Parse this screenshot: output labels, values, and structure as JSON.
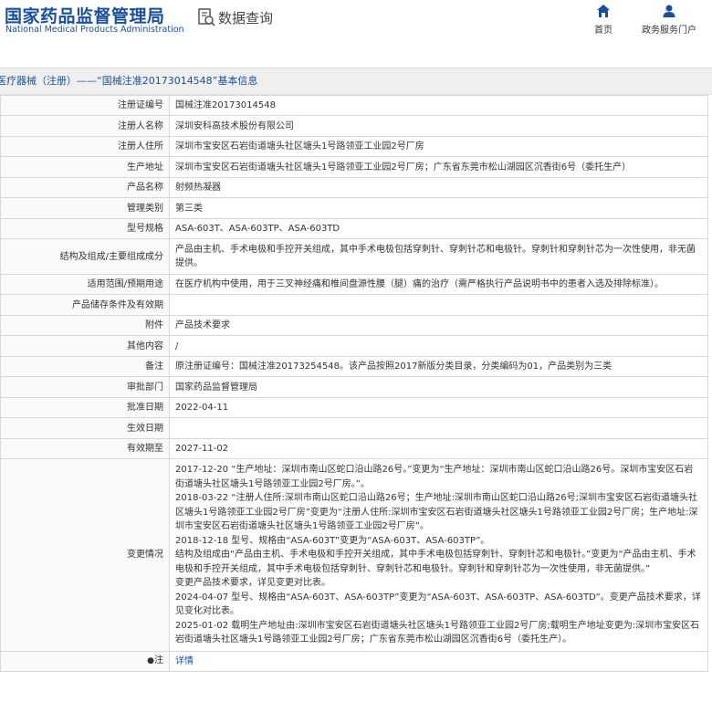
{
  "header": {
    "logo_cn": "国家药品监督管理局",
    "logo_en": "National Medical Products Administration",
    "search_label": "数据查询",
    "nav_home": "首页",
    "nav_gov": "政务服务门户"
  },
  "breadcrumb": "医疗器械（注册）——“国械注准20173014548”基本信息",
  "rows": [
    {
      "label": "注册证编号",
      "value": "国械注准20173014548"
    },
    {
      "label": "注册人名称",
      "value": "深圳安科高技术股份有限公司"
    },
    {
      "label": "注册人住所",
      "value": "深圳市宝安区石岩街道塘头社区塘头1号路领亚工业园2号厂房"
    },
    {
      "label": "生产地址",
      "value": "深圳市宝安区石岩街道塘头社区塘头1号路领亚工业园2号厂房；广东省东莞市松山湖园区沉香街6号（委托生产）"
    },
    {
      "label": "产品名称",
      "value": "射频热凝器"
    },
    {
      "label": "管理类别",
      "value": "第三类"
    },
    {
      "label": "型号规格",
      "value": "ASA-603T、ASA-603TP、ASA-603TD"
    },
    {
      "label": "结构及组成/主要组成成分",
      "value": "产品由主机、手术电极和手控开关组成，其中手术电极包括穿刺针、穿刺针芯和电极针。穿刺针和穿刺针芯为一次性使用，非无菌提供。"
    },
    {
      "label": "适用范围/预期用途",
      "value": "在医疗机构中使用，用于三叉神经痛和椎间盘源性腰（腿）痛的治疗（需严格执行产品说明书中的患者入选及排除标准）。"
    },
    {
      "label": "产品储存条件及有效期",
      "value": ""
    },
    {
      "label": "附件",
      "value": "产品技术要求"
    },
    {
      "label": "其他内容",
      "value": "/"
    },
    {
      "label": "备注",
      "value": "原注册证编号：国械注准20173254548。该产品按照2017新版分类目录，分类编码为01，产品类别为三类"
    },
    {
      "label": "审批部门",
      "value": "国家药品监督管理局"
    },
    {
      "label": "批准日期",
      "value": "2022-04-11"
    },
    {
      "label": "生效日期",
      "value": ""
    },
    {
      "label": "有效期至",
      "value": "2027-11-02"
    }
  ],
  "changes": {
    "label": "变更情况",
    "lines": [
      "2017-12-20 “生产地址：深圳市南山区蛇口沿山路26号。”变更为“生产地址：深圳市南山区蛇口沿山路26号。深圳市宝安区石岩街道塘头社区塘头1号路领亚工业园2号厂房。”。",
      "2018-03-22 “注册人住所:深圳市南山区蛇口沿山路26号；生产地址:深圳市南山区蛇口沿山路26号;深圳市宝安区石岩街道塘头社区塘头1号路领亚工业园2号厂房”变更为“注册人住所:深圳市宝安区石岩街道塘头社区塘头1号路领亚工业园2号厂房；生产地址:深圳市宝安区石岩街道塘头社区塘头1号路领亚工业园2号厂房”。",
      "2018-12-18 型号、规格由“ASA-603T”变更为“ASA-603T、ASA-603TP”。",
      "结构及组成由“产品由主机、手术电极和手控开关组成，其中手术电极包括穿刺针、穿刺针芯和电极针。”变更为“产品由主机、手术电极和手控开关组成，其中手术电极包括穿刺针、穿刺针芯和电极针。穿刺针和穿刺针芯为一次性使用，非无菌提供。”",
      "变更产品技术要求，详见变更对比表。",
      "2024-04-07 型号、规格由“ASA-603T、ASA-603TP”变更为“ASA-603T、ASA-603TP、ASA-603TD”。变更产品技术要求，详见变化对比表。",
      "2025-01-02 载明生产地址由:深圳市宝安区石岩街道塘头社区塘头1号路领亚工业园2号厂房;载明生产地址变更为:深圳市宝安区石岩街道塘头社区塘头1号路领亚工业园2号厂房；广东省东莞市松山湖园区沉香街6号（委托生产）。"
    ]
  },
  "note": {
    "label": "注",
    "icon": "info-icon",
    "link": "详情"
  }
}
